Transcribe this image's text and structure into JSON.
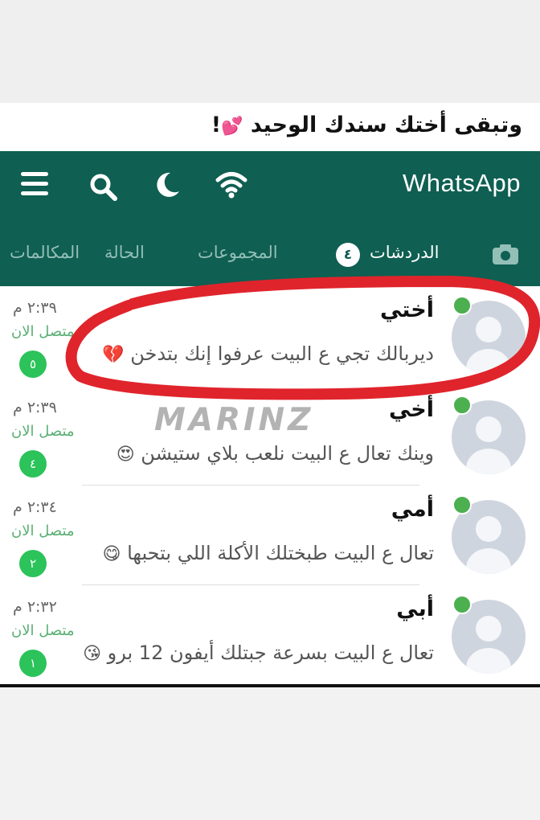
{
  "caption": {
    "text": "وتبقى أختك سندك الوحيد",
    "heart": "💕",
    "suffix": "!"
  },
  "app": {
    "title": "WhatsApp",
    "icons": [
      "menu-icon",
      "search-icon",
      "moon-icon",
      "wifi-icon",
      "camera-icon"
    ],
    "colors": {
      "header": "#0f5f52",
      "online": "#4caf50",
      "unread": "#2bc35a",
      "highlight": "#e0242c"
    }
  },
  "tabs": {
    "calls": "المكالمات",
    "status": "الحالة",
    "groups": "المجموعات",
    "chats": "الدردشات",
    "chats_badge": "٤"
  },
  "chats": [
    {
      "name": "أختي",
      "preview": "ديربالك تجي ع البيت عرفوا إنك بتدخن",
      "emoji": "💔",
      "time": "٢:٣٩ م",
      "status": "متصل الان",
      "unread": "٥"
    },
    {
      "name": "أخي",
      "preview": "وينك تعال ع البيت نلعب بلاي ستيشن",
      "emoji": "😍",
      "time": "٢:٣٩ م",
      "status": "متصل الان",
      "unread": "٤"
    },
    {
      "name": "أمي",
      "preview": "تعال ع البيت طبختلك الأكلة اللي بتحبها",
      "emoji": "😋",
      "time": "٢:٣٤ م",
      "status": "متصل الان",
      "unread": "٢"
    },
    {
      "name": "أبي",
      "preview": "تعال ع البيت بسرعة جبتلك أيفون 12 برو",
      "emoji": "😘",
      "time": "٢:٣٢ م",
      "status": "متصل الان",
      "unread": "١"
    }
  ],
  "watermark": "MARINZ"
}
